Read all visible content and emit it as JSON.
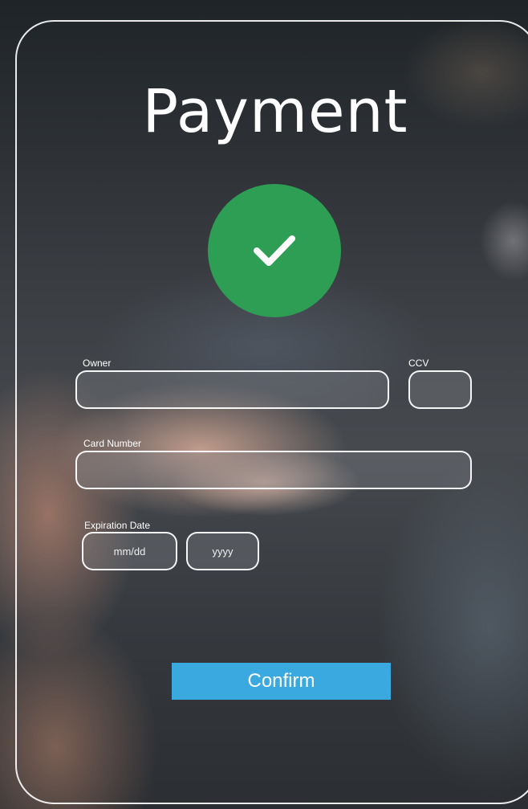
{
  "title": "Payment",
  "status": {
    "icon": "checkmark-icon",
    "color": "#2f9e55"
  },
  "form": {
    "owner": {
      "label": "Owner",
      "value": "",
      "placeholder": ""
    },
    "ccv": {
      "label": "CCV",
      "value": "",
      "placeholder": ""
    },
    "card_number": {
      "label": "Card Number",
      "value": "",
      "placeholder": ""
    },
    "expiration": {
      "label": "Expiration Date",
      "month_day": {
        "value": "",
        "placeholder": "mm/dd"
      },
      "year": {
        "value": "",
        "placeholder": "yyyy"
      }
    }
  },
  "confirm_label": "Confirm",
  "colors": {
    "accent": "#3aa9df",
    "success": "#2f9e55",
    "text": "#ffffff"
  }
}
